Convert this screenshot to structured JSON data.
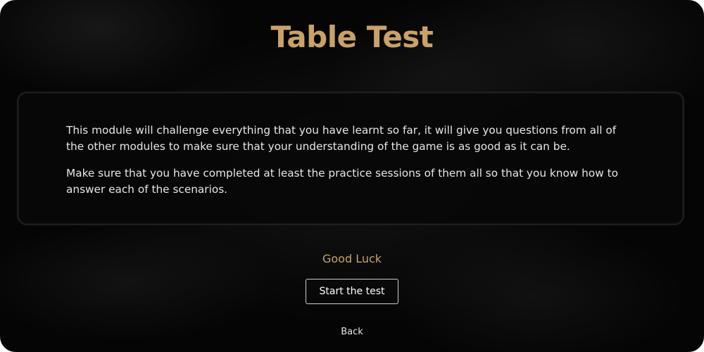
{
  "page": {
    "title": "Table Test"
  },
  "intro": {
    "paragraphs": [
      "This module will challenge everything that you have learnt so far, it will give you questions from all of the other modules to make sure that your understanding of the game is as good as it can be.",
      "Make sure that you have completed at least the practice sessions of them all so that you know how to answer each of the scenarios."
    ]
  },
  "footer": {
    "good_luck": "Good Luck",
    "start_label": "Start the test",
    "back_label": "Back"
  },
  "colors": {
    "accent": "#c9a16a",
    "background": "#050505",
    "panel": "#080808",
    "text": "#e6e6e6"
  }
}
